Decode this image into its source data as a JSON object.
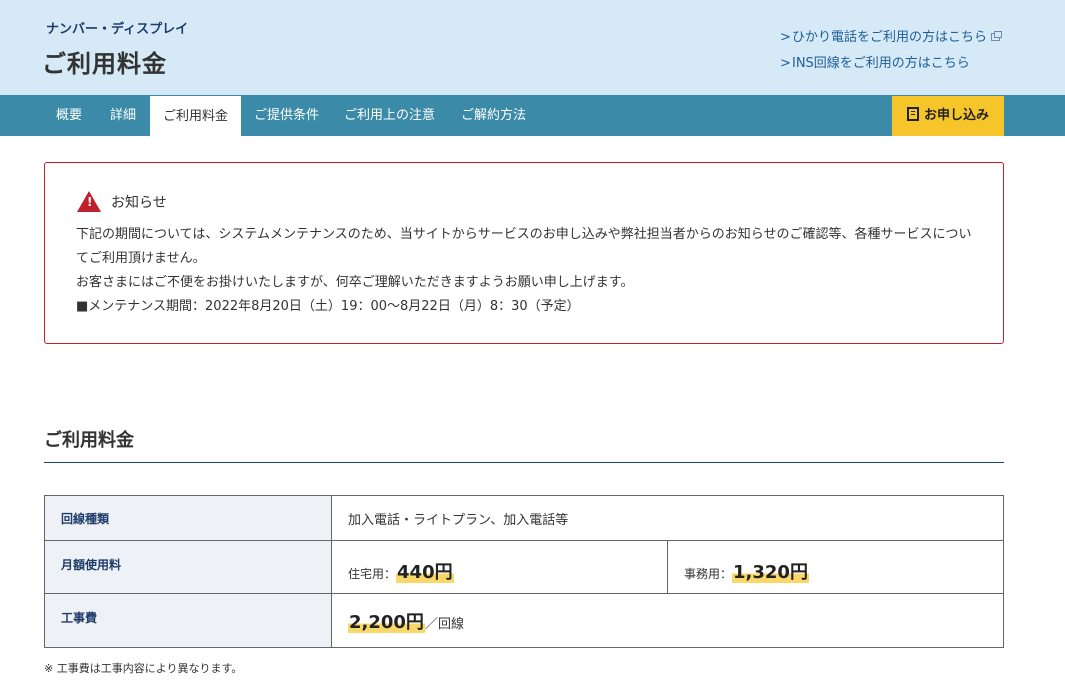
{
  "header": {
    "service_name": "ナンバー・ディスプレイ",
    "page_title": "ご利用料金",
    "links": [
      {
        "chevron": ">",
        "label": "ひかり電話をご利用の方はこちら"
      },
      {
        "chevron": ">",
        "label": "INS回線をご利用の方はこちら"
      }
    ]
  },
  "nav": {
    "tabs": [
      "概要",
      "詳細",
      "ご利用料金",
      "ご提供条件",
      "ご利用上の注意",
      "ご解約方法"
    ],
    "active_tab": "ご利用料金",
    "apply_label": "お申し込み"
  },
  "notice": {
    "icon": "warning-icon",
    "icon_glyph": "!",
    "title": "お知らせ",
    "lines": [
      "下記の期間については、システムメンテナンスのため、当サイトからサービスのお申し込みや弊社担当者からのお知らせのご確認等、各種サービスについてご利用頂けません。",
      "お客さまにはご不便をお掛けいたしますが、何卒ご理解いただきますようお願い申し上げます。",
      "■メンテナンス期間：2022年8月20日（土）19：00〜8月22日（月）8：30（予定）"
    ]
  },
  "section": {
    "title": "ご利用料金"
  },
  "table": {
    "rows": [
      {
        "header": "回線種類",
        "value": "加入電話・ライトプラン、加入電話等"
      },
      {
        "header": "月額使用料",
        "residential_label": "住宅用：",
        "residential_price": "440円",
        "business_label": "事務用：",
        "business_price": "1,320円"
      },
      {
        "header": "工事費",
        "price": "2,200円",
        "suffix": "／回線"
      }
    ]
  },
  "footnote": "※ 工事費は工事内容により異なります。",
  "colors": {
    "header_bg": "#d5e9f6",
    "nav_bg": "#3b8ba8",
    "apply_bg": "#f5c52a",
    "notice_border": "#c0202b",
    "highlight": "#f9d86a"
  }
}
